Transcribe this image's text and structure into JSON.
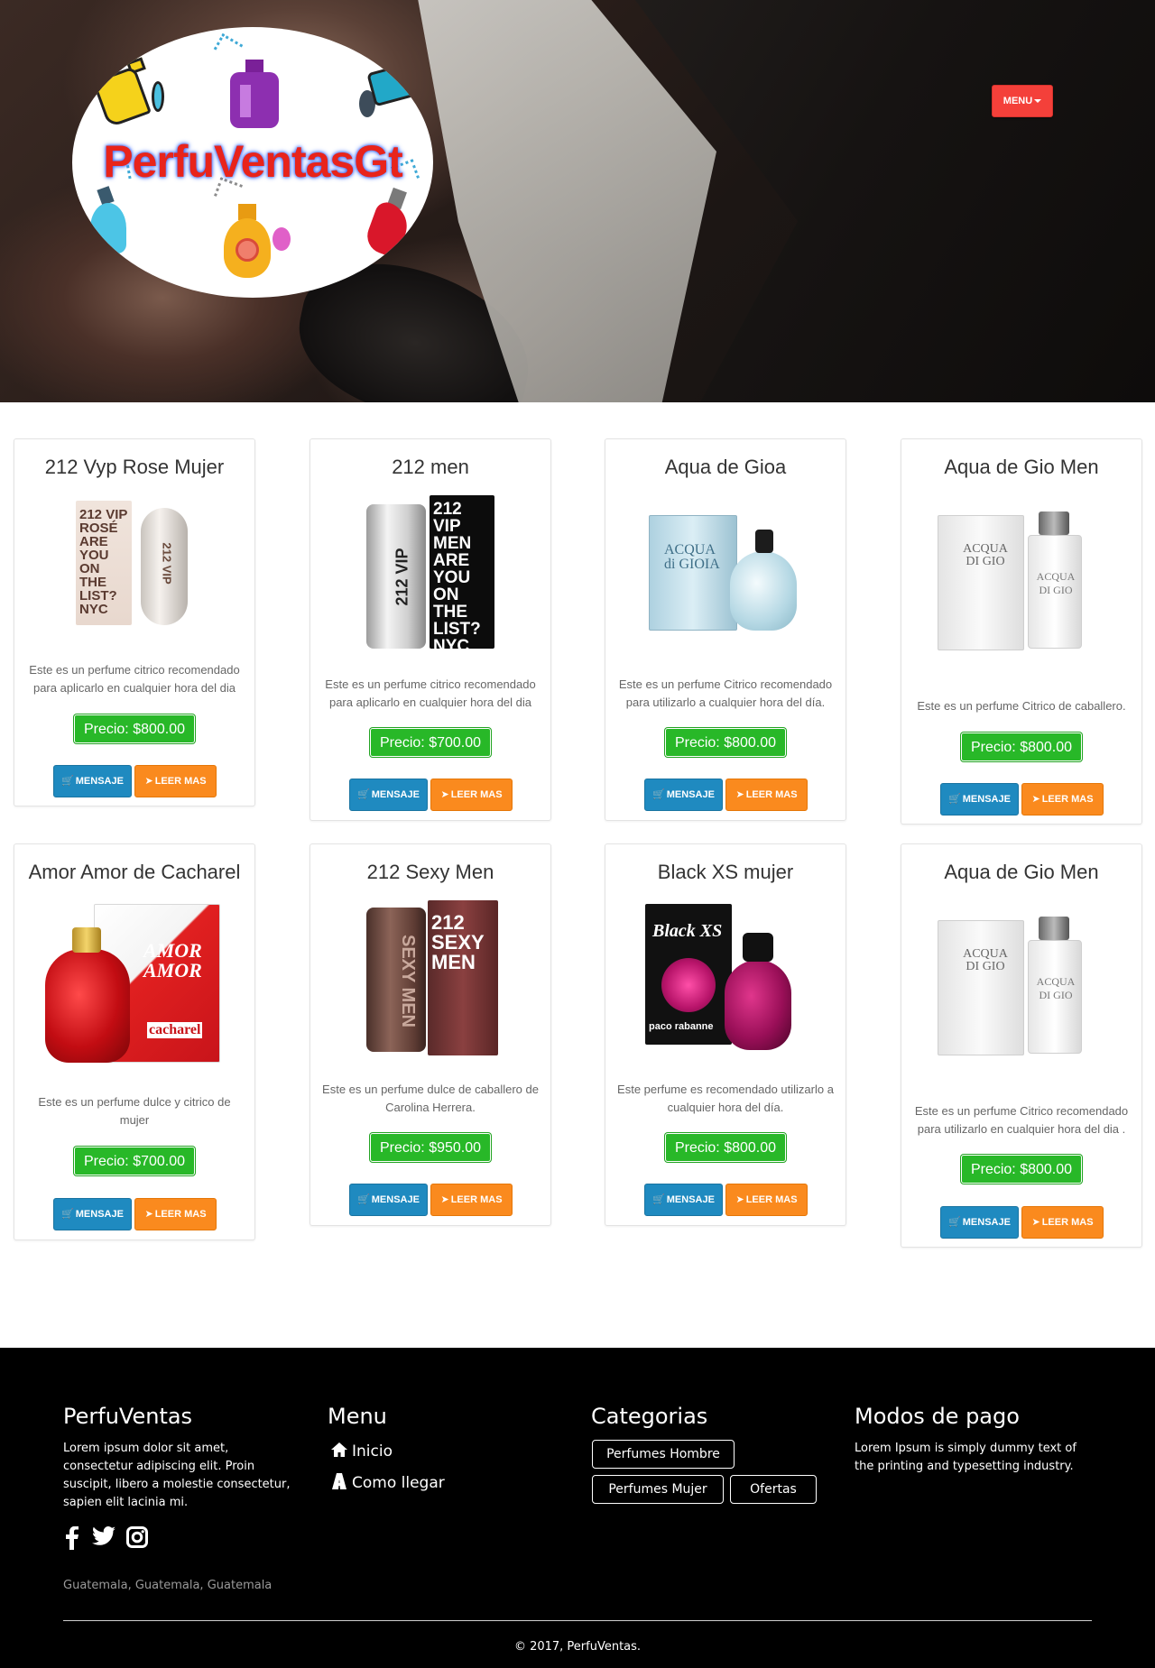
{
  "brand": {
    "logo_text": "PerfuVentasGt"
  },
  "nav": {
    "menu_label": "MENU"
  },
  "products": [
    {
      "name": "212 Vyp Rose Mujer",
      "description": "Este es un perfume citrico recomendado para aplicarlo en cualquier hora del dia",
      "price": "Precio: $800.00",
      "msg_label": "MENSAJE",
      "more_label": "LEER MAS"
    },
    {
      "name": "212 men",
      "description": "Este es un perfume citrico recomendado para aplicarlo en cualquier hora del dia",
      "price": "Precio: $700.00",
      "msg_label": "MENSAJE",
      "more_label": "LEER MAS"
    },
    {
      "name": "Aqua de Gioa",
      "description": "Este es un perfume Citrico recomendado para utilizarlo a cualquier hora del día.",
      "price": "Precio: $800.00",
      "msg_label": "MENSAJE",
      "more_label": "LEER MAS"
    },
    {
      "name": "Aqua de Gio Men",
      "description": "Este es un perfume Citrico de caballero.",
      "price": "Precio: $800.00",
      "msg_label": "MENSAJE",
      "more_label": "LEER MAS"
    },
    {
      "name": "Amor Amor de Cacharel",
      "description": "Este es un perfume dulce y citrico de mujer",
      "price": "Precio: $700.00",
      "msg_label": "MENSAJE",
      "more_label": "LEER MAS"
    },
    {
      "name": "212 Sexy Men",
      "description": "Este es un perfume dulce de caballero de Carolina Herrera.",
      "price": "Precio: $950.00",
      "msg_label": "MENSAJE",
      "more_label": "LEER MAS"
    },
    {
      "name": "Black XS mujer",
      "description": "Este perfume es recomendado utilizarlo a cualquier hora del día.",
      "price": "Precio: $800.00",
      "msg_label": "MENSAJE",
      "more_label": "LEER MAS"
    },
    {
      "name": "Aqua de Gio Men",
      "description": "Este es un perfume Citrico recomendado para utilizarlo en cualquier hora del dia .",
      "price": "Precio: $800.00",
      "msg_label": "MENSAJE",
      "more_label": "LEER MAS"
    }
  ],
  "packaging_text": {
    "p1_box": "212 VIP ROSÉ ARE YOU ON THE LIST? NYC",
    "p1_bottle": "212 VIP",
    "p2_box": "212 VIP MEN ARE YOU ON THE LIST? NYC",
    "p2_bottle": "212 VIP",
    "p3_box": "ACQUA di GIOIA",
    "p4_box": "ACQUA DI GIO",
    "p5_box": "AMOR AMOR",
    "p5_brand": "cacharel",
    "p6_box": "212 SEXY MEN",
    "p6_bottle": "SEXY MEN",
    "p7_box": "Black XS",
    "p7_brand": "paco rabanne",
    "p8_box": "ACQUA DI GIO"
  },
  "footer": {
    "about": {
      "title": "PerfuVentas",
      "text": "Lorem ipsum dolor sit amet, consectetur adipiscing elit. Proin suscipit, libero a molestie consectetur, sapien elit lacinia mi."
    },
    "menu": {
      "title": "Menu",
      "items": [
        "Inicio",
        "Como llegar"
      ]
    },
    "categories": {
      "title": "Categorias",
      "items": [
        "Perfumes Hombre",
        "Perfumes Mujer",
        "Ofertas"
      ]
    },
    "payment": {
      "title": "Modos de pago",
      "text": "Lorem Ipsum is simply dummy text of the printing and typesetting industry."
    },
    "address": "Guatemala, Guatemala, Guatemala",
    "copyright": "© 2017, PerfuVentas."
  },
  "icons": [
    "facebook-icon",
    "twitter-icon",
    "instagram-icon",
    "home-icon",
    "road-icon",
    "cart-icon",
    "arrow-circle-icon"
  ],
  "colors": {
    "price_green": "#28b828",
    "message_blue": "#1f8ac0",
    "more_orange": "#fa8a1e",
    "menu_red": "#f4403a",
    "logo_red": "#e8241b"
  }
}
